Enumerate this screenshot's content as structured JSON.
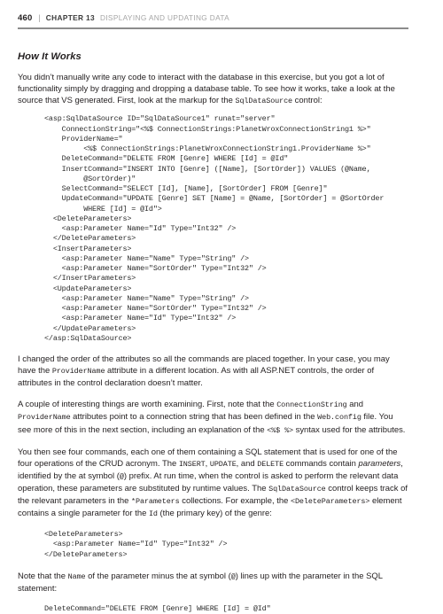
{
  "header": {
    "folio": "460",
    "separator": "|",
    "chapter_label": "CHAPTER 13",
    "chapter_title": "DISPLAYING AND UPDATING DATA"
  },
  "section": {
    "heading": "How It Works"
  },
  "paragraphs": {
    "p1_a": "You didn’t manually write any code to interact with the database in this exercise, but you got a lot of functionality simply by dragging and dropping a database table. To see how it works, take a look at the source that VS generated. First, look at the markup for the ",
    "p1_code": "SqlDataSource",
    "p1_b": " control:",
    "p2_a": "I changed the order of the attributes so all the commands are placed together. In your case, you may have the ",
    "p2_code": "ProviderName",
    "p2_b": " attribute in a different location. As with all ASP.NET controls, the order of attributes in the control declaration doesn’t matter.",
    "p3_a": "A couple of interesting things are worth examining. First, note that the ",
    "p3_code1": "ConnectionString",
    "p3_b": " and ",
    "p3_code2": "ProviderName",
    "p3_c": " attributes point to a connection string that has been defined in the ",
    "p3_code3": "Web.config",
    "p3_d": " file. You see more of this in the next section, including an explanation of the ",
    "p3_code4": "<%$ %>",
    "p3_e": " syntax used for the attributes.",
    "p4_a": "You then see four commands, each one of them containing a SQL statement that is used for one of the four operations of the CRUD acronym. The ",
    "p4_code1": "INSERT",
    "p4_b": ", ",
    "p4_code2": "UPDATE",
    "p4_c": ", and ",
    "p4_code3": "DELETE",
    "p4_d": " commands contain ",
    "p4_em": "parameters",
    "p4_e": ", identified by the at symbol (",
    "p4_code4": "@",
    "p4_f": ") prefix. At run time, when the control is asked to perform the relevant data operation, these parameters are substituted by runtime values. The ",
    "p4_code5": "SqlDataSource",
    "p4_g": " control keeps track of the relevant parameters in the ",
    "p4_code6": "*Parameters",
    "p4_h": " collections. For example, the ",
    "p4_code7": "<DeleteParameters>",
    "p4_i": " element contains a single parameter for the ",
    "p4_code8": "Id",
    "p4_j": " (the primary key) of the genre:",
    "p5_a": "Note that the ",
    "p5_code1": "Name",
    "p5_b": " of the parameter minus the at symbol (",
    "p5_code2": "@",
    "p5_c": ") lines up with the parameter in the SQL statement:"
  },
  "code_blocks": {
    "main": "<asp:SqlDataSource ID=\"SqlDataSource1\" runat=\"server\"\n    ConnectionString=\"<%$ ConnectionStrings:PlanetWroxConnectionString1 %>\"\n    ProviderName=\"\n         <%$ ConnectionStrings:PlanetWroxConnectionString1.ProviderName %>\"\n    DeleteCommand=\"DELETE FROM [Genre] WHERE [Id] = @Id\"\n    InsertCommand=\"INSERT INTO [Genre] ([Name], [SortOrder]) VALUES (@Name,\n         @SortOrder)\"\n    SelectCommand=\"SELECT [Id], [Name], [SortOrder] FROM [Genre]\"\n    UpdateCommand=\"UPDATE [Genre] SET [Name] = @Name, [SortOrder] = @SortOrder\n         WHERE [Id] = @Id\">\n  <DeleteParameters>\n    <asp:Parameter Name=\"Id\" Type=\"Int32\" />\n  </DeleteParameters>\n  <InsertParameters>\n    <asp:Parameter Name=\"Name\" Type=\"String\" />\n    <asp:Parameter Name=\"SortOrder\" Type=\"Int32\" />\n  </InsertParameters>\n  <UpdateParameters>\n    <asp:Parameter Name=\"Name\" Type=\"String\" />\n    <asp:Parameter Name=\"SortOrder\" Type=\"Int32\" />\n    <asp:Parameter Name=\"Id\" Type=\"Int32\" />\n  </UpdateParameters>\n</asp:SqlDataSource>",
    "delete_params": "<DeleteParameters>\n  <asp:Parameter Name=\"Id\" Type=\"Int32\" />\n</DeleteParameters>",
    "delete_command": "DeleteCommand=\"DELETE FROM [Genre] WHERE [Id] = @Id\""
  },
  "colors": {
    "text": "#231f20",
    "rule": "#8c8c8c",
    "chapter_title": "#a6a6a6",
    "code": "#2b2b2b",
    "page_background": "#ffffff"
  }
}
